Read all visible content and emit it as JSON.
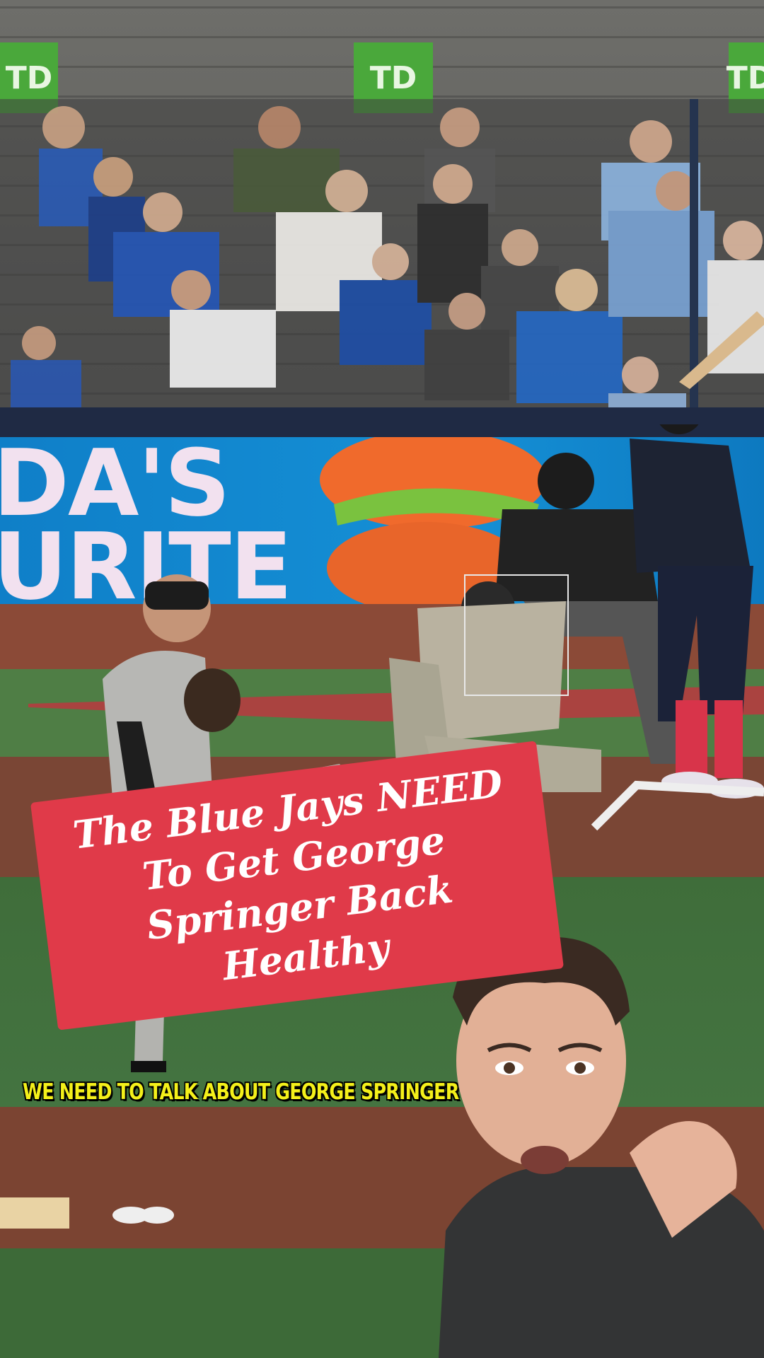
{
  "stadium": {
    "sponsor_logos": [
      "TD",
      "TD",
      "TD"
    ],
    "banner_text": "DA'S\nURITE"
  },
  "overlay": {
    "title": "The Blue Jays NEED To Get George Springer Back Healthy",
    "caption": "WE NEED TO TALK ABOUT GEORGE SPRINGER"
  },
  "colors": {
    "title_background": "#e03a49",
    "caption_text": "#f4f01a",
    "banner_background": "#1590d6"
  }
}
